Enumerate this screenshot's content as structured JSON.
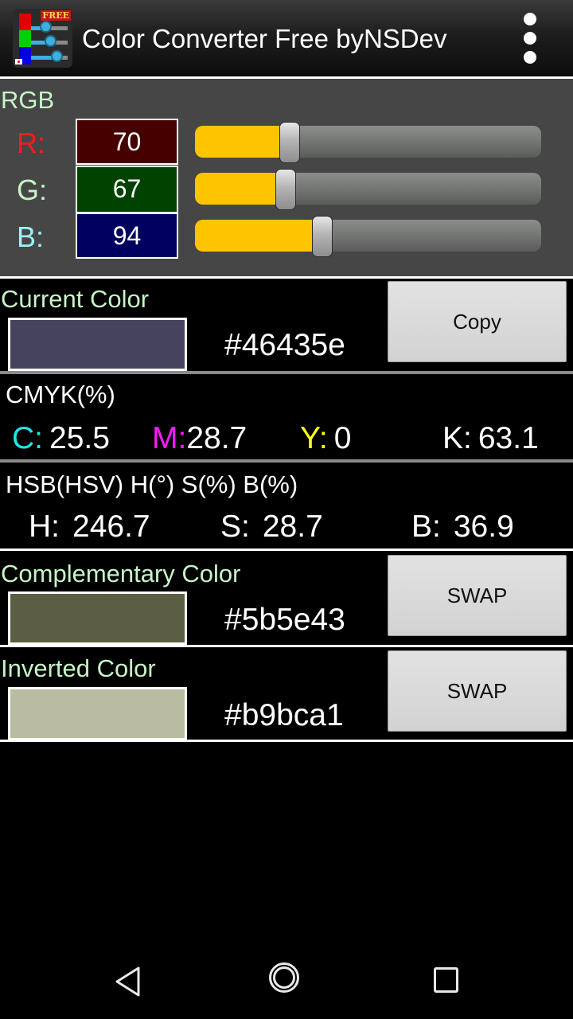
{
  "app_bar": {
    "title": "Color Converter Free byNSDev",
    "icon_badge": "FREE",
    "menu_icon": "overflow-menu-icon"
  },
  "rgb": {
    "label": "RGB",
    "channels": [
      {
        "label": "R:",
        "value": "70",
        "max": 255,
        "label_color": "#ff1a1a",
        "box_color": "#460000"
      },
      {
        "label": "G:",
        "value": "67",
        "max": 255,
        "label_color": "#c6f5c6",
        "box_color": "#004300"
      },
      {
        "label": "B:",
        "value": "94",
        "max": 255,
        "label_color": "#9af3f3",
        "box_color": "#00005e"
      }
    ],
    "slider_fill_color": "#ffc400"
  },
  "current_color": {
    "label": "Current Color",
    "hex": "#46435e",
    "swatch": "#46435e",
    "button": "Copy"
  },
  "cmyk": {
    "label": "CMYK(%)",
    "items": [
      {
        "key": "C:",
        "value": "25.5",
        "key_color": "#1ee6e6"
      },
      {
        "key": "M:",
        "value": "28.7",
        "key_color": "#ff1aff"
      },
      {
        "key": "Y:",
        "value": "0",
        "key_color": "#ffff1a"
      },
      {
        "key": "K:",
        "value": "63.1",
        "key_color": "#ffffff"
      }
    ]
  },
  "hsb": {
    "label": "HSB(HSV) H(°) S(%) B(%)",
    "items": [
      {
        "key": "H:",
        "value": "246.7"
      },
      {
        "key": "S:",
        "value": "28.7"
      },
      {
        "key": "B:",
        "value": "36.9"
      }
    ]
  },
  "complementary": {
    "label": "Complementary Color",
    "hex": "#5b5e43",
    "swatch": "#5b5e43",
    "button": "SWAP"
  },
  "inverted": {
    "label": "Inverted Color",
    "hex": "#b9bca1",
    "swatch": "#b9bca1",
    "button": "SWAP"
  },
  "nav": {
    "back": "back-icon",
    "home": "home-icon",
    "recents": "recents-icon"
  }
}
